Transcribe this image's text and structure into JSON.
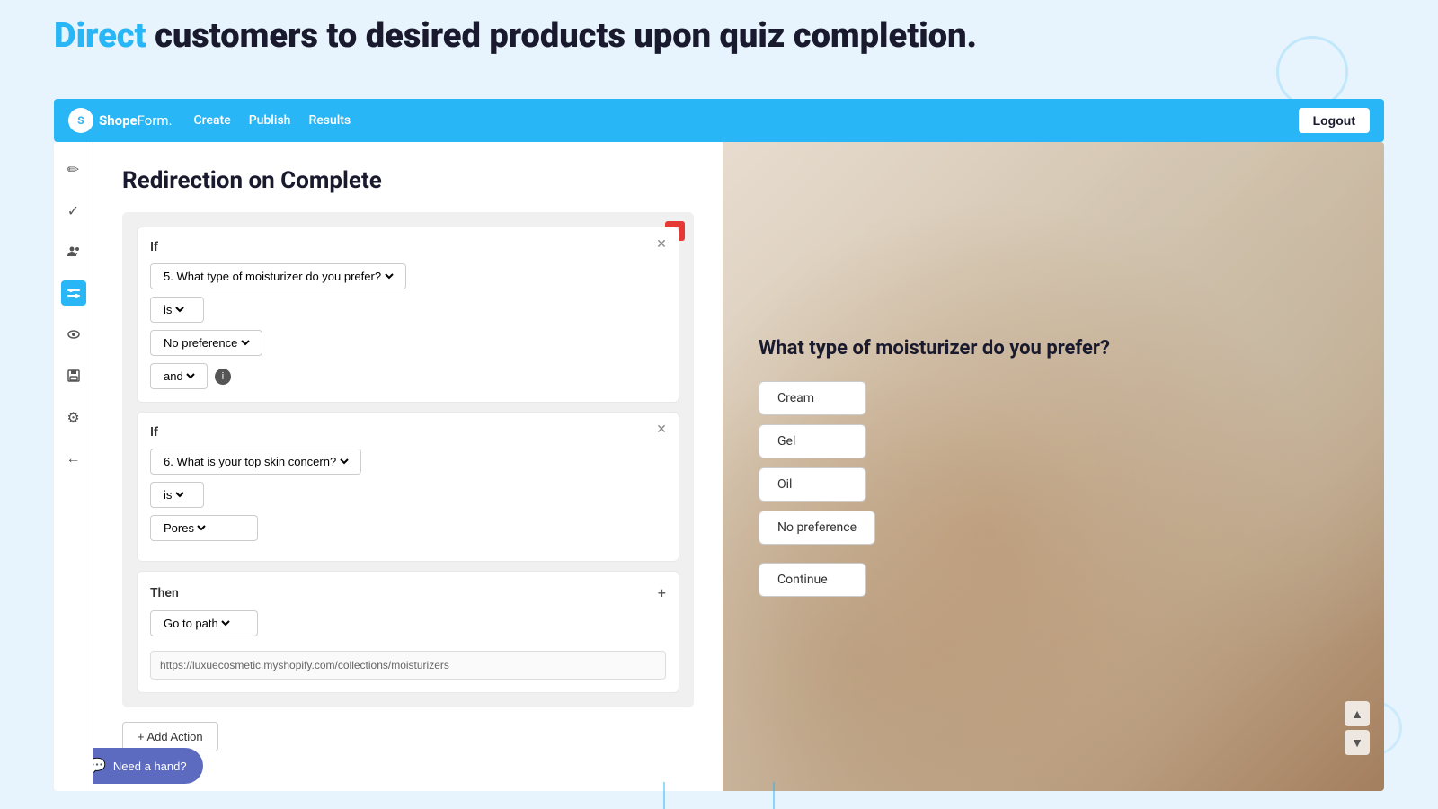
{
  "hero": {
    "heading_direct": "Direct",
    "heading_rest": " customers to desired products upon quiz completion."
  },
  "navbar": {
    "brand": "ShopeForm.",
    "nav_items": [
      "Create",
      "Publish",
      "Results"
    ],
    "logout_label": "Logout"
  },
  "sidebar": {
    "icons": [
      {
        "name": "edit-icon",
        "symbol": "✏️",
        "active": false
      },
      {
        "name": "check-icon",
        "symbol": "✔",
        "active": false
      },
      {
        "name": "users-icon",
        "symbol": "👥",
        "active": false
      },
      {
        "name": "sliders-icon",
        "symbol": "⇄",
        "active": true
      },
      {
        "name": "eye-icon",
        "symbol": "👁",
        "active": false
      },
      {
        "name": "save-icon",
        "symbol": "💾",
        "active": false
      },
      {
        "name": "settings-icon",
        "symbol": "⚙",
        "active": false
      },
      {
        "name": "back-icon",
        "symbol": "←",
        "active": false
      }
    ]
  },
  "panel": {
    "title": "Redirection on Complete",
    "if_block_1": {
      "label": "If",
      "question_select": "5. What type of moisturizer do you prefer?",
      "operator_select": "is",
      "answer_select": "No preference",
      "connector": "and"
    },
    "if_block_2": {
      "label": "If",
      "question_select": "6. What is your top skin concern?",
      "operator_select": "is",
      "answer_select": "Pores"
    },
    "then_block": {
      "label": "Then",
      "action_select": "Go to path",
      "url_value": "https://luxuecosmetic.myshopify.com/collections/moisturizers"
    },
    "add_action_label": "+ Add Action"
  },
  "preview": {
    "question": "What type of moisturizer do you prefer?",
    "options": [
      "Cream",
      "Gel",
      "Oil",
      "No preference"
    ],
    "continue_label": "Continue"
  },
  "help": {
    "label": "Need a hand?"
  }
}
